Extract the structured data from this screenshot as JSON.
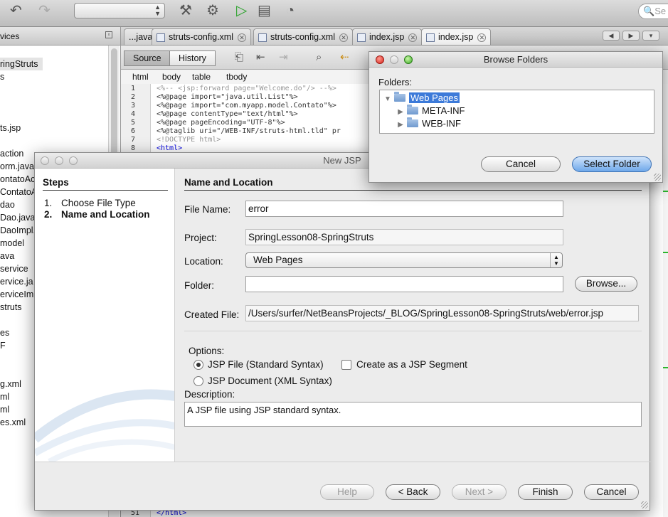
{
  "toolbar": {
    "search_placeholder": "Se",
    "icons": [
      "undo-icon",
      "redo-icon",
      "hammer-icon",
      "clean-build-icon",
      "run-icon",
      "debug-icon",
      "profile-icon"
    ]
  },
  "left_panel": {
    "tab_label": "vices",
    "items": [
      "ringStruts",
      "s",
      "ts.jsp",
      "action",
      "orm.java",
      "ontatoAct",
      "ContatoAc",
      "dao",
      "Dao.java",
      "DaoImpl.ja",
      "model",
      "ava",
      "service",
      "ervice.ja",
      "erviceIm",
      "struts",
      "es",
      "F",
      "g.xml",
      "ml",
      "ml",
      "es.xml"
    ]
  },
  "editor": {
    "tabs": [
      {
        "label": "...java"
      },
      {
        "label": "struts-config.xml"
      },
      {
        "label": "struts-config.xml"
      },
      {
        "label": "index.jsp"
      },
      {
        "label": "index.jsp"
      }
    ],
    "source_label": "Source",
    "history_label": "History",
    "breadcrumb": [
      "html",
      "body",
      "table",
      "tbody"
    ],
    "lines": [
      {
        "n": "1",
        "t": "<%-- <jsp:forward page=\"Welcome.do\"/> --%>"
      },
      {
        "n": "2",
        "t": "<%@page import=\"java.util.List\"%>"
      },
      {
        "n": "3",
        "t": "<%@page import=\"com.myapp.model.Contato\"%>"
      },
      {
        "n": "4",
        "t": "<%@page contentType=\"text/html\"%>"
      },
      {
        "n": "5",
        "t": "<%@page pageEncoding=\"UTF-8\"%>"
      },
      {
        "n": "6",
        "t": "<%@taglib uri=\"/WEB-INF/struts-html.tld\" pr"
      },
      {
        "n": "7",
        "t": "<!DOCTYPE html>"
      },
      {
        "n": "8",
        "t": "<html>"
      }
    ],
    "last_line_num": "51",
    "last_line": "</html>"
  },
  "new_jsp": {
    "title": "New JSP",
    "steps_header": "Steps",
    "steps": [
      {
        "num": "1.",
        "label": "Choose File Type"
      },
      {
        "num": "2.",
        "label": "Name and Location"
      }
    ],
    "section_title": "Name and Location",
    "file_name_label": "File Name:",
    "file_name": "error",
    "project_label": "Project:",
    "project": "SpringLesson08-SpringStruts",
    "location_label": "Location:",
    "location": "Web Pages",
    "folder_label": "Folder:",
    "folder": "",
    "browse_label": "Browse...",
    "created_file_label": "Created File:",
    "created_file": "/Users/surfer/NetBeansProjects/_BLOG/SpringLesson08-SpringStruts/web/error.jsp",
    "options_label": "Options:",
    "option_standard": "JSP File (Standard Syntax)",
    "option_xml": "JSP Document (XML Syntax)",
    "option_segment": "Create as a JSP Segment",
    "description_label": "Description:",
    "description": "A JSP file using JSP standard syntax.",
    "buttons": {
      "help": "Help",
      "back": "< Back",
      "next": "Next >",
      "finish": "Finish",
      "cancel": "Cancel"
    }
  },
  "browse_folders": {
    "title": "Browse Folders",
    "folders_label": "Folders:",
    "root": "Web Pages",
    "children": [
      "META-INF",
      "WEB-INF"
    ],
    "cancel": "Cancel",
    "select": "Select Folder"
  }
}
